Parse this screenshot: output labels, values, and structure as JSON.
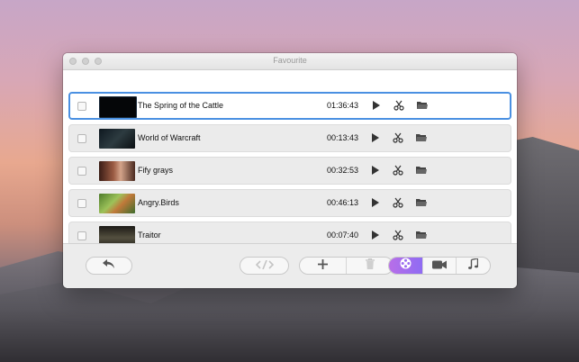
{
  "window": {
    "title": "Favourite"
  },
  "videos": [
    {
      "name": "The Spring of the Cattle",
      "duration": "01:36:43"
    },
    {
      "name": "World of Warcraft",
      "duration": "00:13:43"
    },
    {
      "name": "Fify grays",
      "duration": "00:32:53"
    },
    {
      "name": "Angry.Birds",
      "duration": "00:46:13"
    },
    {
      "name": "Traitor",
      "duration": "00:07:40"
    }
  ],
  "icons": {
    "play": "play-icon",
    "cut": "scissors-icon",
    "folder": "folder-icon",
    "back": "undo-arrow-icon",
    "code": "code-icon",
    "add": "plus-icon",
    "delete": "trash-icon",
    "mode_film": "film-reel-icon",
    "mode_video": "video-camera-icon",
    "mode_music": "music-note-icon"
  },
  "colors": {
    "selection_border": "#4a90e2",
    "active_mode_gradient_start": "#b86ee8",
    "active_mode_gradient_end": "#8f6cf3"
  }
}
